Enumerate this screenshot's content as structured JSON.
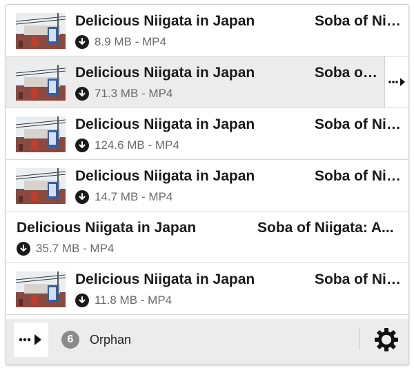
{
  "items": [
    {
      "title": "Delicious Niigata in Japan",
      "subtitle": "Soba of Niigata: A...",
      "size": "8.9 MB",
      "format": "MP4"
    },
    {
      "title": "Delicious Niigata in Japan",
      "subtitle": "Soba of Niigata: A...",
      "size": "71.3 MB",
      "format": "MP4"
    },
    {
      "title": "Delicious Niigata in Japan",
      "subtitle": "Soba of Niigata: A...",
      "size": "124.6 MB",
      "format": "MP4"
    },
    {
      "title": "Delicious Niigata in Japan",
      "subtitle": "Soba of Niigata: A...",
      "size": "14.7 MB",
      "format": "MP4"
    },
    {
      "title": "Delicious Niigata in Japan",
      "subtitle": "Soba of Niigata: A...",
      "size": "35.7 MB",
      "format": "MP4"
    },
    {
      "title": "Delicious Niigata in Japan",
      "subtitle": "Soba of Niigata: A...",
      "size": "11.8 MB",
      "format": "MP4"
    }
  ],
  "meta_separator": " - ",
  "footer": {
    "count": "6",
    "label": "Orphan"
  },
  "icons": {
    "download": "download-circle-icon",
    "more": "more-arrow-icon",
    "settings": "gear-icon"
  }
}
